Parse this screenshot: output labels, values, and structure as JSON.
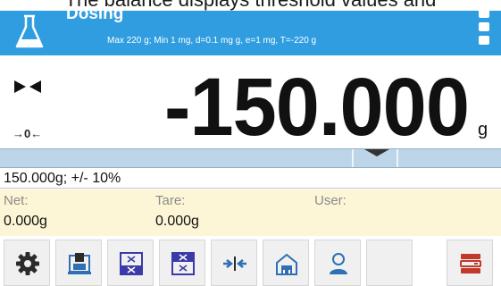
{
  "caption": "The balance displays threshold values and",
  "header": {
    "title": "Dosing",
    "specs": "Max 220 g; Min 1 mg, d=0.1 mg g, e=1 mg, T=-220 g",
    "background": "#2f9de0",
    "app_icon": "flask-icon",
    "menu_icon": "kebab-menu-icon"
  },
  "display": {
    "weight": "-150.000",
    "unit": "g",
    "zero_indicator": "→0←",
    "stability_icon": "stable-indicator-icon"
  },
  "bargraph": {
    "fill_color": "#bcd5e8",
    "pointer_icon": "bargraph-pointer-icon"
  },
  "threshold": {
    "text": "150.000g; +/- 10%"
  },
  "info": {
    "background": "#fdf6d6",
    "net_label": "Net:",
    "net_value": "0.000g",
    "tare_label": "Tare:",
    "tare_value": "0.000g",
    "user_label": "User:",
    "user_value": ""
  },
  "toolbar": {
    "buttons": [
      {
        "icon": "gear-icon"
      },
      {
        "icon": "printer-icon"
      },
      {
        "icon": "threshold-low-icon"
      },
      {
        "icon": "threshold-high-icon"
      },
      {
        "icon": "zero-icon"
      },
      {
        "icon": "tare-icon"
      },
      {
        "icon": "user-icon"
      },
      {
        "icon": "empty"
      },
      {
        "icon": "database-icon"
      }
    ]
  }
}
